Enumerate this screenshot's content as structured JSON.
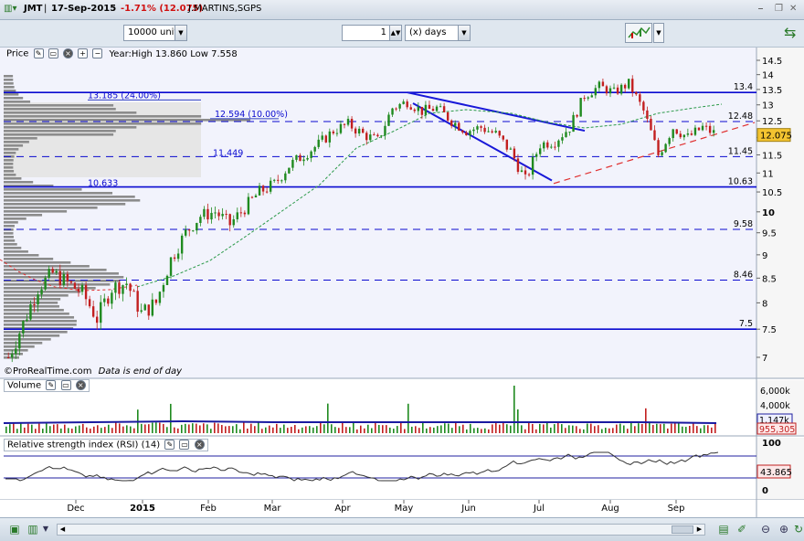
{
  "window": {
    "ticker": "JMT",
    "date": "17-Sep-2015",
    "change": "-1.71% (12.075)",
    "instrument": "J.MARTINS,SGPS"
  },
  "toolbar": {
    "units_value": "10000 units",
    "period_value": "1",
    "period_unit": "(x) days"
  },
  "price_panel": {
    "label": "Price",
    "year_info": "Year:High 13.860 Low 7.558",
    "watermark": "©ProRealTime.com",
    "note": "Data is end of day"
  },
  "volume_panel": {
    "label": "Volume"
  },
  "rsi_panel": {
    "label": "Relative strength index (RSI) (14)"
  },
  "chart_data": [
    {
      "type": "candlestick",
      "title": "J.MARTINS,SGPS",
      "y_axis_ticks": [
        "14.5",
        "14",
        "13.5",
        "13",
        "12.5",
        "12",
        "11.5",
        "11",
        "10.5",
        "10",
        "9.5",
        "9",
        "8.5",
        "8",
        "7.5",
        "7"
      ],
      "ylim": [
        6.6,
        14.8
      ],
      "x_axis_ticks": [
        "Dec",
        "2015",
        "Feb",
        "Mar",
        "Apr",
        "May",
        "Jun",
        "Jul",
        "Aug",
        "Sep"
      ],
      "last_price": "12.075",
      "horizontal_levels": [
        {
          "value": 13.4,
          "label": "13.4",
          "style": "solid"
        },
        {
          "value": 12.48,
          "label": "12.48",
          "style": "dashed"
        },
        {
          "value": 11.45,
          "label": "11.45",
          "style": "dashed"
        },
        {
          "value": 10.63,
          "label": "10.63",
          "style": "solid"
        },
        {
          "value": 9.58,
          "label": "9.58",
          "style": "dashed"
        },
        {
          "value": 8.46,
          "label": "8.46",
          "style": "dashed"
        },
        {
          "value": 7.5,
          "label": "7.5",
          "style": "solid"
        }
      ],
      "retracement_labels": [
        {
          "value": 13.185,
          "label": "13.185 (24.00%)"
        },
        {
          "value": 12.594,
          "label": "12.594 (10.00%)"
        },
        {
          "value": 11.449,
          "label": "11.449"
        },
        {
          "value": 10.633,
          "label": "10.633"
        }
      ],
      "close_path": [
        [
          "Nov",
          7.0
        ],
        [
          "Nov",
          7.6
        ],
        [
          "Nov",
          8.3
        ],
        [
          "Nov",
          8.6
        ],
        [
          "Dec",
          8.4
        ],
        [
          "Dec",
          8.2
        ],
        [
          "Dec",
          7.7
        ],
        [
          "Dec",
          8.3
        ],
        [
          "2015",
          8.4
        ],
        [
          "2015",
          7.8
        ],
        [
          "2015",
          8.0
        ],
        [
          "2015",
          8.9
        ],
        [
          "2015",
          9.5
        ],
        [
          "Feb",
          9.9
        ],
        [
          "Feb",
          10.0
        ],
        [
          "Feb",
          9.7
        ],
        [
          "Feb",
          10.1
        ],
        [
          "Mar",
          10.5
        ],
        [
          "Mar",
          10.7
        ],
        [
          "Mar",
          11.2
        ],
        [
          "Mar",
          11.5
        ],
        [
          "Apr",
          11.8
        ],
        [
          "Apr",
          12.2
        ],
        [
          "Apr",
          12.4
        ],
        [
          "Apr",
          12.1
        ],
        [
          "Apr",
          11.9
        ],
        [
          "May",
          12.9
        ],
        [
          "May",
          13.1
        ],
        [
          "May",
          12.8
        ],
        [
          "May",
          12.9
        ],
        [
          "Jun",
          12.5
        ],
        [
          "Jun",
          12.2
        ],
        [
          "Jun",
          12.3
        ],
        [
          "Jun",
          12.1
        ],
        [
          "Jul",
          11.6
        ],
        [
          "Jul",
          10.8
        ],
        [
          "Jul",
          11.8
        ],
        [
          "Jul",
          11.9
        ],
        [
          "Jul",
          12.3
        ],
        [
          "Aug",
          13.3
        ],
        [
          "Aug",
          13.6
        ],
        [
          "Aug",
          13.4
        ],
        [
          "Aug",
          13.7
        ],
        [
          "Aug",
          12.8
        ],
        [
          "Aug",
          11.5
        ],
        [
          "Sep",
          12.3
        ],
        [
          "Sep",
          12.0
        ],
        [
          "Sep",
          12.3
        ],
        [
          "Sep",
          12.075
        ]
      ]
    },
    {
      "type": "bar",
      "title": "Volume",
      "y_axis_ticks": [
        "6,000k",
        "4,000k"
      ],
      "value_labels": [
        "1,147k",
        "955,305"
      ]
    },
    {
      "type": "line",
      "title": "Relative strength index (RSI) (14)",
      "y_axis_ticks": [
        "100",
        "0"
      ],
      "last_value": "43.865"
    }
  ]
}
